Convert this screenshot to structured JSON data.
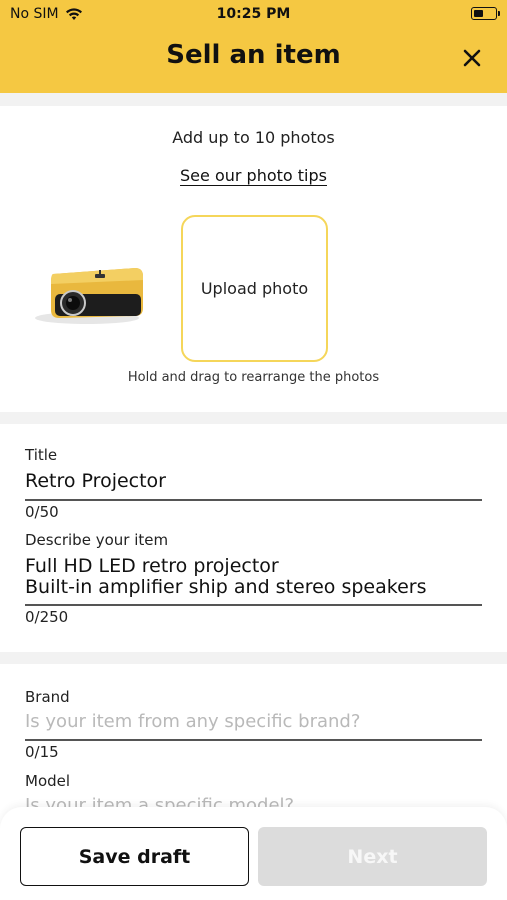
{
  "status_bar": {
    "carrier": "No SIM",
    "time": "10:25 PM",
    "icons": [
      "wifi-icon",
      "battery-icon"
    ]
  },
  "header": {
    "title": "Sell an item",
    "close_icon": "close-icon"
  },
  "photos": {
    "add_text": "Add up to 10 photos",
    "tips_link": "See our photo tips",
    "upload_label": "Upload photo",
    "drag_hint": "Hold and drag to rearrange the photos",
    "thumbnail_icon": "projector-photo"
  },
  "form": {
    "title_label": "Title",
    "title_value": "Retro Projector",
    "title_counter": "0/50",
    "description_label": "Describe your item",
    "description_line1": "Full HD LED retro projector",
    "description_line2": "Built-in amplifier ship and stereo speakers",
    "description_counter": "0/250",
    "brand_label": "Brand",
    "brand_placeholder": "Is your item from any specific brand?",
    "brand_counter": "0/15",
    "model_label": "Model",
    "model_placeholder": "Is your item a specific model?"
  },
  "footer": {
    "save_draft": "Save draft",
    "next": "Next",
    "next_enabled": false
  },
  "colors": {
    "accent": "#f5c842",
    "upload_border": "#f5d65a",
    "disabled_button": "#dcdcdc"
  }
}
